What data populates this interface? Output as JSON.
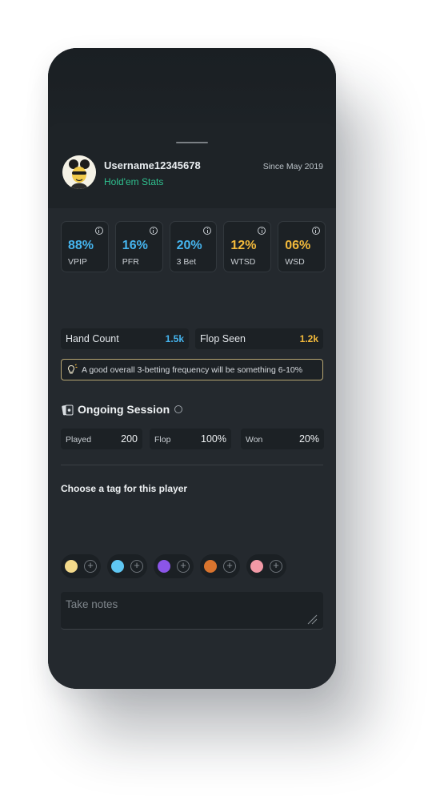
{
  "profile": {
    "username": "Username12345678",
    "game_type": "Hold'em Stats",
    "since": "Since May 2019"
  },
  "stats": [
    {
      "value": "88%",
      "label": "VPIP",
      "color": "#45b4ee"
    },
    {
      "value": "16%",
      "label": "PFR",
      "color": "#45b4ee"
    },
    {
      "value": "20%",
      "label": "3 Bet",
      "color": "#45b4ee"
    },
    {
      "value": "12%",
      "label": "WTSD",
      "color": "#f2b93b"
    },
    {
      "value": "06%",
      "label": "WSD",
      "color": "#f2b93b"
    }
  ],
  "counts": {
    "hand_count": {
      "label": "Hand Count",
      "value": "1.5k",
      "color": "#45b4ee"
    },
    "flop_seen": {
      "label": "Flop Seen",
      "value": "1.2k",
      "color": "#f2b93b"
    }
  },
  "tip": "A good overall 3-betting frequency will be something 6-10%",
  "session": {
    "title": "Ongoing Session",
    "items": [
      {
        "label": "Played",
        "value": "200"
      },
      {
        "label": "Flop",
        "value": "100%"
      },
      {
        "label": "Won",
        "value": "20%"
      }
    ]
  },
  "tags": {
    "title": "Choose a tag for this player",
    "colors": [
      "#f3d98b",
      "#5fc7f3",
      "#8b55e8",
      "#d9742e",
      "#f199a6"
    ]
  },
  "notes": {
    "placeholder": "Take notes",
    "value": ""
  }
}
